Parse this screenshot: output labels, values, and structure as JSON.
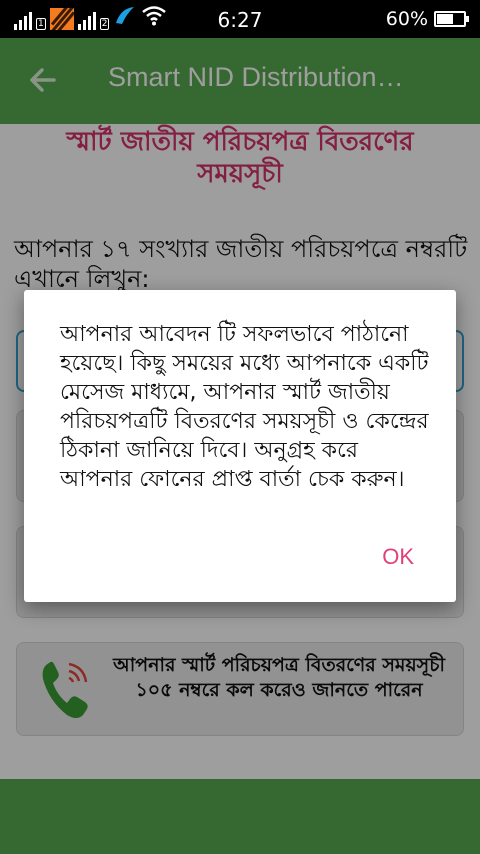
{
  "status_bar": {
    "time": "6:27",
    "battery_text": "60%",
    "battery_level": 0.6,
    "icons": [
      "signal-icon",
      "sim-1-icon",
      "carrier-icon",
      "signal-icon",
      "sim-2-icon",
      "carrier-icon",
      "wifi-icon",
      "battery-icon"
    ]
  },
  "app_bar": {
    "title": "Smart NID Distribution…",
    "back_icon": "back-arrow-icon",
    "color": "#58a94f"
  },
  "page": {
    "heading": "স্মার্ট জাতীয় পরিচয়পত্র বিতরণের সময়সূচী",
    "prompt": "আপনার ১৭ সংখ্যার জাতীয় পরিচয়পত্রে নম্বরটি এখানে লিখুন:",
    "call_info": "আপনার স্মার্ট পরিচয়পত্র বিতরণের সময়সূচী ১০৫ নম্বরে কল করেও জানতে পারেন",
    "accent_color": "#d6336c"
  },
  "dialog": {
    "message": "আপনার আবেদন টি সফলভাবে পাঠানো হয়েছে। কিছু সময়ের মধ্যে আপনাকে একটি মেসেজ মাধ্যমে, আপনার স্মার্ট জাতীয় পরিচয়পত্রটি বিতরণের সময়সূচী ও কেন্দ্রের ঠিকানা জানিয়ে দিবে। অনুগ্রহ করে আপনার ফোনের প্রাপ্ত বার্তা চেক করুন।",
    "ok_label": "OK",
    "ok_color": "#e0407b"
  }
}
